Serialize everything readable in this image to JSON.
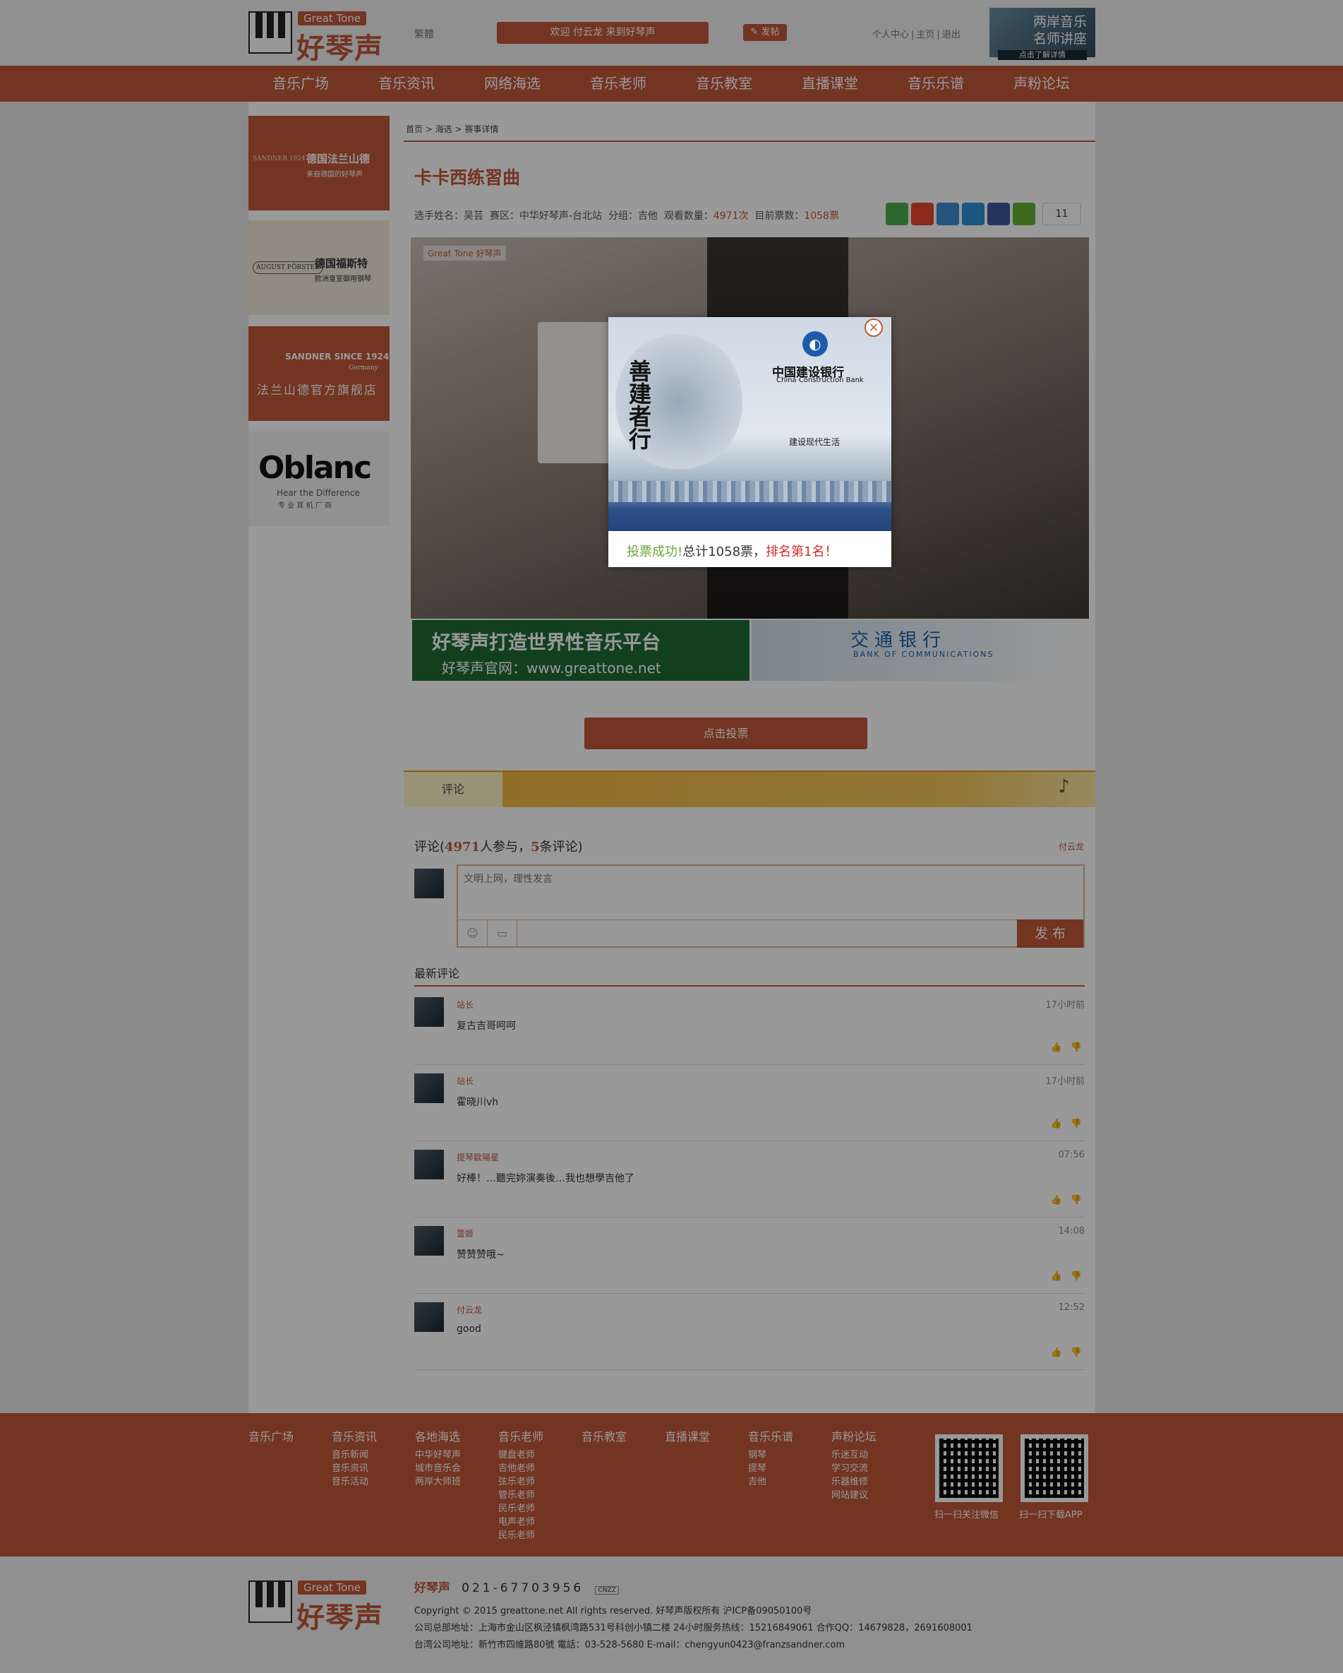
{
  "header": {
    "logo_badge": "Great Tone",
    "logo_name": "好琴声",
    "lang_toggle": "繁體",
    "welcome": "欢迎 付云龙 来到好琴声",
    "post_button": "发帖",
    "links": [
      "个人中心",
      "主页",
      "退出"
    ],
    "promo_line1": "两岸音乐",
    "promo_line2": "名师讲座",
    "promo_cta": "点击了解详情"
  },
  "nav": [
    "音乐广场",
    "音乐资讯",
    "网络海选",
    "音乐老师",
    "音乐教室",
    "直播课堂",
    "音乐乐谱",
    "声粉论坛"
  ],
  "sidebar_ads": [
    {
      "title": "德国法兰山德",
      "sub": "来自德国的好琴声",
      "mark": "SANDNER 1924"
    },
    {
      "title": "德国福斯特",
      "sub": "欧洲皇室御用钢琴",
      "mark": "AUGUST FÖRSTER"
    },
    {
      "title": "SANDNER SINCE 1924",
      "sub": "Germany",
      "cn": "法兰山德官方旗舰店"
    },
    {
      "title": "Oblanc",
      "sub": "Hear the Difference",
      "cn": "专 业 耳 机 厂 商"
    }
  ],
  "breadcrumb": [
    "首页",
    "海选",
    "赛事详情"
  ],
  "contest": {
    "title": "卡卡西练習曲",
    "player_label": "选手姓名：",
    "player": "吴芸",
    "region_label": "赛区：",
    "region": "中华好琴声-台北站",
    "group_label": "分组：",
    "group": "吉他",
    "views_label": "观看数量：",
    "views": "4971次",
    "votes_label": "目前票数：",
    "votes": "1058票",
    "share_count": "11",
    "vote_button": "点击投票"
  },
  "video": {
    "watermark": "Great Tone 好琴声"
  },
  "banners": {
    "left_line1": "好琴声打造世界性音乐平台",
    "left_line2": "好琴声官网：www.greattone.net",
    "right_line1": "交通银行",
    "right_line2": "BANK OF COMMUNICATIONS"
  },
  "comments": {
    "tab": "评论",
    "count_prefix": "评论(",
    "participants": "4971",
    "count_mid": "人参与，",
    "total": "5",
    "count_suffix": "条评论)",
    "current_user": "付云龙",
    "placeholder": "文明上网，理性发言",
    "publish": "发 布",
    "latest_heading": "最新评论",
    "items": [
      {
        "user": "站长",
        "time": "17小时前",
        "text": "复古吉哥呵呵"
      },
      {
        "user": "站长",
        "time": "17小时前",
        "text": "霍晓川vh"
      },
      {
        "user": "提琴歐陽星",
        "time": "07:56",
        "text": "好棒！…聽完妳演奏後…我也想學吉他了"
      },
      {
        "user": "蕾姬",
        "time": "14:08",
        "text": "赞赞赞哦~"
      },
      {
        "user": "付云龙",
        "time": "12:52",
        "text": "good"
      }
    ]
  },
  "footer": {
    "columns": [
      {
        "head": "音乐广场",
        "items": []
      },
      {
        "head": "音乐资讯",
        "items": [
          "音乐新闻",
          "音乐资讯",
          "音乐活动"
        ]
      },
      {
        "head": "各地海选",
        "items": [
          "中华好琴声",
          "城市音乐会",
          "两岸大师班"
        ]
      },
      {
        "head": "音乐老师",
        "items": [
          "键盘老师",
          "吉他老师",
          "弦乐老师",
          "管乐老师",
          "民乐老师",
          "电声老师",
          "民乐老师"
        ]
      },
      {
        "head": "音乐教室",
        "items": []
      },
      {
        "head": "直播课堂",
        "items": []
      },
      {
        "head": "音乐乐谱",
        "items": [
          "钢琴",
          "提琴",
          "吉他"
        ]
      },
      {
        "head": "声粉论坛",
        "items": [
          "乐迷互动",
          "学习交流",
          "乐器维修",
          "网站建议"
        ]
      }
    ],
    "qr1_label": "扫一扫关注微信",
    "qr2_label": "扫一扫下载APP",
    "brand": "好琴声",
    "phone": "021-67703956",
    "cnzz": "CNZZ",
    "copyright": "Copyright © 2015 greattone.net All rights reserved. 好琴声版权所有 沪ICP备09050100号",
    "address1": "公司总部地址：上海市金山区枫泾镇枫湾路531号科创小镇二楼 24小时服务热线：15216849061 合作QQ：14679828，2691608001",
    "address2": "台湾公司地址：新竹市四維路80號 電話：03-528-5680 E-mail：chengyun0423@franzsandner.com"
  },
  "modal": {
    "bank_cn": "中国建设银行",
    "bank_en": "China Construction Bank",
    "slogan_calligraphy": "善建者行",
    "slogan": "建设现代生活",
    "ok": "投票成功!",
    "summary": "总计1058票，",
    "rank": "排名第1名！"
  },
  "colors": {
    "brand": "#c0573a",
    "comment_bar": "#f1b53c",
    "success": "#6ca23a",
    "rank": "#d02a2a"
  }
}
